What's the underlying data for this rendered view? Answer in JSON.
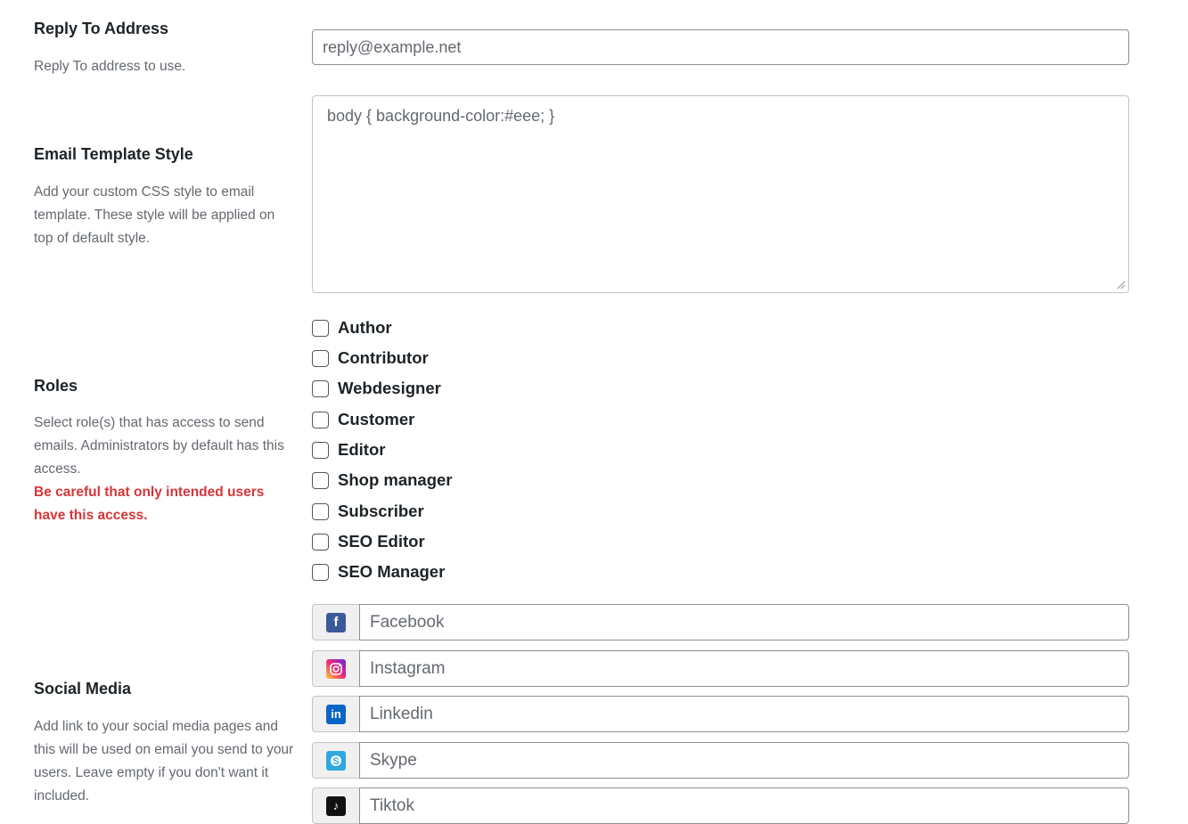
{
  "reply_to": {
    "title": "Reply To Address",
    "description": "Reply To address to use.",
    "placeholder": "reply@example.net"
  },
  "email_style": {
    "title": "Email Template Style",
    "description": "Add your custom CSS style to email template. These style will be applied on top of default style.",
    "placeholder": "body { background-color:#eee; }"
  },
  "roles": {
    "title": "Roles",
    "description": "Select role(s) that has access to send emails. Administrators by default has this access.",
    "warning": "Be careful that only intended users have this access.",
    "items": [
      {
        "label": "Author",
        "checked": false
      },
      {
        "label": "Contributor",
        "checked": false
      },
      {
        "label": "Webdesigner",
        "checked": false
      },
      {
        "label": "Customer",
        "checked": false
      },
      {
        "label": "Editor",
        "checked": false
      },
      {
        "label": "Shop manager",
        "checked": false
      },
      {
        "label": "Subscriber",
        "checked": false
      },
      {
        "label": "SEO Editor",
        "checked": false
      },
      {
        "label": "SEO Manager",
        "checked": false
      }
    ]
  },
  "social": {
    "title": "Social Media",
    "description": "Add link to your social media pages and this will be used on email you send to your users. Leave empty if you don't want it included.",
    "items": [
      {
        "icon": "facebook-icon",
        "placeholder": "Facebook",
        "color": "#3b5998"
      },
      {
        "icon": "instagram-icon",
        "placeholder": "Instagram",
        "color": "#e1306c"
      },
      {
        "icon": "linkedin-icon",
        "placeholder": "Linkedin",
        "color": "#0a66c2"
      },
      {
        "icon": "skype-icon",
        "placeholder": "Skype",
        "color": "#2fa7e0"
      },
      {
        "icon": "tiktok-icon",
        "placeholder": "Tiktok",
        "color": "#111111"
      }
    ]
  }
}
